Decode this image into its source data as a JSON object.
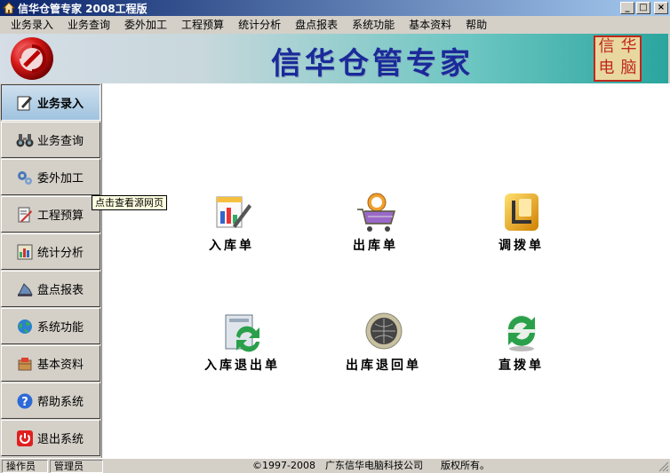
{
  "window": {
    "title": "信华仓管专家  2008工程版",
    "minimize": "_",
    "maximize": "□",
    "close": "×"
  },
  "menu": [
    "业务录入",
    "业务查询",
    "委外加工",
    "工程预算",
    "统计分析",
    "盘点报表",
    "系统功能",
    "基本资料",
    "帮助"
  ],
  "banner": {
    "title": "信华仓管专家",
    "seal": [
      "信",
      "华",
      "电",
      "脑"
    ]
  },
  "sidebar": [
    {
      "label": "业务录入",
      "icon": "edit-doc-icon",
      "active": true
    },
    {
      "label": "业务查询",
      "icon": "binoculars-icon",
      "active": false
    },
    {
      "label": "委外加工",
      "icon": "gears-icon",
      "active": false
    },
    {
      "label": "工程预算",
      "icon": "calculator-doc-icon",
      "active": false
    },
    {
      "label": "统计分析",
      "icon": "chart-icon",
      "active": false
    },
    {
      "label": "盘点报表",
      "icon": "report-icon",
      "active": false
    },
    {
      "label": "系统功能",
      "icon": "globe-icon",
      "active": false
    },
    {
      "label": "基本资料",
      "icon": "box-icon",
      "active": false
    },
    {
      "label": "帮助系统",
      "icon": "help-icon",
      "active": false
    },
    {
      "label": "退出系统",
      "icon": "power-icon",
      "active": false
    }
  ],
  "tooltip": "点击查看源网页",
  "tiles": [
    {
      "label": "入库单",
      "icon": "stock-in-icon"
    },
    {
      "label": "出库单",
      "icon": "cart-icon"
    },
    {
      "label": "调拨单",
      "icon": "transfer-folder-icon"
    },
    {
      "label": "入库退出单",
      "icon": "return-in-icon"
    },
    {
      "label": "出库退回单",
      "icon": "return-out-globe-icon"
    },
    {
      "label": "直拨单",
      "icon": "direct-transfer-icon"
    }
  ],
  "status": {
    "operator_label": "操作员",
    "operator_value": "管理员",
    "copyright": "©1997-2008",
    "company": "广东信华电脑科技公司",
    "rights": "版权所有。"
  }
}
